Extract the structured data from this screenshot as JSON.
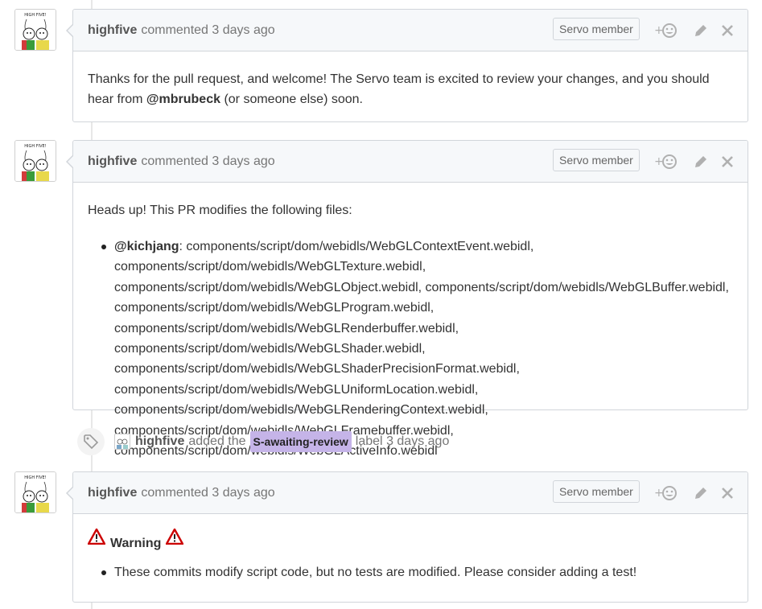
{
  "comments": [
    {
      "author": "highfive",
      "action": "commented",
      "time": "3 days ago",
      "badge": "Servo member",
      "body_before": "Thanks for the pull request, and welcome! The Servo team is excited to review your changes, and you should hear from ",
      "mention": "@mbrubeck",
      "body_after": " (or someone else) soon."
    },
    {
      "author": "highfive",
      "action": "commented",
      "time": "3 days ago",
      "badge": "Servo member",
      "intro": "Heads up! This PR modifies the following files:",
      "mention": "@kichjang",
      "files_text": ": components/script/dom/webidls/WebGLContextEvent.webidl, components/script/dom/webidls/WebGLTexture.webidl, components/script/dom/webidls/WebGLObject.webidl, components/script/dom/webidls/WebGLBuffer.webidl, components/script/dom/webidls/WebGLProgram.webidl, components/script/dom/webidls/WebGLRenderbuffer.webidl, components/script/dom/webidls/WebGLShader.webidl, components/script/dom/webidls/WebGLShaderPrecisionFormat.webidl, components/script/dom/webidls/WebGLUniformLocation.webidl, components/script/dom/webidls/WebGLRenderingContext.webidl, components/script/dom/webidls/WebGLFramebuffer.webidl, components/script/dom/webidls/WebGLActiveInfo.webidl"
    },
    {
      "author": "highfive",
      "action": "commented",
      "time": "3 days ago",
      "badge": "Servo member",
      "warning_title": "Warning",
      "warning_item": "These commits modify script code, but no tests are modified. Please consider adding a test!"
    }
  ],
  "label_event": {
    "author": "highfive",
    "text_before": "added the",
    "label": "S-awaiting-review",
    "text_after": "label",
    "time": "3 days ago",
    "label_color": "#c5b4e8"
  },
  "avatar_text": "HIGH FIVE!",
  "colors": {
    "header_bg": "#f6f8fa",
    "border": "#d1d5da",
    "warning_red": "#cc0000"
  },
  "icons": [
    "add-reaction-icon",
    "pencil-icon",
    "close-icon",
    "tag-icon",
    "warning-icon"
  ]
}
